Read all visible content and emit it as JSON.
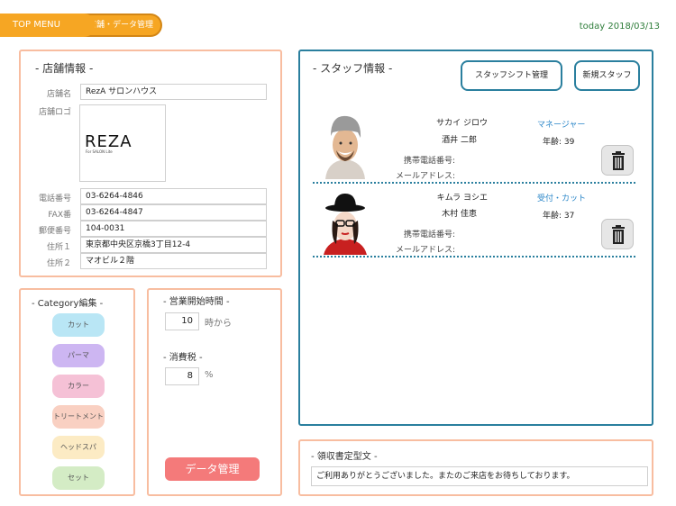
{
  "nav": {
    "top_menu": "TOP MENU",
    "current": "店舗・データ管理",
    "today": "today 2018/03/13"
  },
  "store": {
    "title": "- 店舗情報 -",
    "name_label": "店舗名",
    "name_value": "RezA サロンハウス",
    "logo_label": "店舗ロゴ",
    "logo_text": "REZA",
    "logo_sub": "For SALON Lite",
    "phone_label": "電話番号",
    "phone_value": "03-6264-4846",
    "fax_label": "FAX番",
    "fax_value": "03-6264-4847",
    "zip_label": "郵便番号",
    "zip_value": "104-0031",
    "addr1_label": "住所１",
    "addr1_value": "東京都中央区京橋3丁目12-4",
    "addr2_label": "住所２",
    "addr2_value": "マオビル２階"
  },
  "category": {
    "title": "- Category編集 -",
    "items": [
      {
        "label": "カット",
        "color": "#b9e6f5"
      },
      {
        "label": "パーマ",
        "color": "#cdb6f2"
      },
      {
        "label": "カラー",
        "color": "#f5c1d6"
      },
      {
        "label": "トリートメント",
        "color": "#f9d0c2"
      },
      {
        "label": "ヘッドスパ",
        "color": "#fcebc4"
      },
      {
        "label": "セット",
        "color": "#d4ecc5"
      }
    ]
  },
  "settings": {
    "open_title": "- 営業開始時間 -",
    "open_value": "10",
    "open_unit": "時から",
    "tax_title": "- 消費税 -",
    "tax_value": "8",
    "tax_unit": "%",
    "data_button": "データ管理"
  },
  "staff": {
    "title": "- スタッフ情報 -",
    "shift_button": "スタッフシフト管理",
    "new_button": "新規スタッフ",
    "phone_label": "携帯電話番号:",
    "mail_label": "メールアドレス:",
    "members": [
      {
        "kana": "サカイ  ジロウ",
        "kanji": "酒井  二郎",
        "role": "マネージャー",
        "age": "年齢: 39"
      },
      {
        "kana": "キムラ  ヨシエ",
        "kanji": "木村  佳恵",
        "role": "受付・カット",
        "age": "年齢: 37"
      }
    ]
  },
  "receipt": {
    "title": "- 領収書定型文 -",
    "text": "ご利用ありがとうございました。またのご来店をお待ちしております。"
  },
  "colors": {
    "accent_orange": "#f6a623",
    "panel_border": "#f8bda0",
    "staff_border": "#2a7f9e",
    "data_button": "#f47a7a"
  }
}
